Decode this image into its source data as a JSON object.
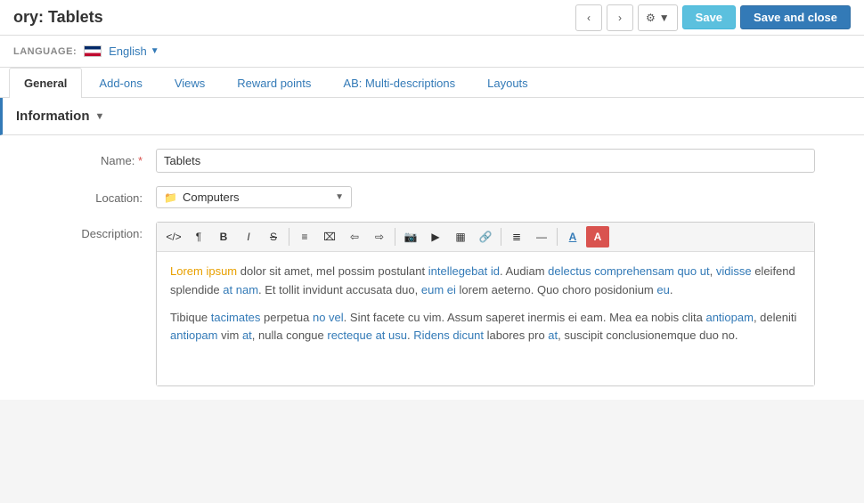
{
  "header": {
    "title": "ory: Tablets",
    "save_label": "Save",
    "save_close_label": "Save and close"
  },
  "language": {
    "label": "LANGUAGE:",
    "current": "English"
  },
  "tabs": [
    {
      "id": "general",
      "label": "General",
      "active": true
    },
    {
      "id": "addons",
      "label": "Add-ons",
      "active": false
    },
    {
      "id": "views",
      "label": "Views",
      "active": false
    },
    {
      "id": "rewardpoints",
      "label": "Reward points",
      "active": false
    },
    {
      "id": "multidesc",
      "label": "AB: Multi-descriptions",
      "active": false
    },
    {
      "id": "layouts",
      "label": "Layouts",
      "active": false
    }
  ],
  "section": {
    "title": "Information"
  },
  "form": {
    "name_label": "Name:",
    "name_required": "*",
    "name_value": "Tablets",
    "location_label": "Location:",
    "location_value": "Computers",
    "description_label": "Description:"
  },
  "editor": {
    "toolbar_buttons": [
      {
        "id": "source",
        "symbol": "</>",
        "title": "Source"
      },
      {
        "id": "paragraph",
        "symbol": "¶",
        "title": "Paragraph"
      },
      {
        "id": "bold",
        "symbol": "B",
        "title": "Bold"
      },
      {
        "id": "italic",
        "symbol": "I",
        "title": "Italic"
      },
      {
        "id": "strikethrough",
        "symbol": "S̶",
        "title": "Strikethrough"
      },
      {
        "id": "unordered-list",
        "symbol": "☰",
        "title": "Unordered List"
      },
      {
        "id": "ordered-list",
        "symbol": "☷",
        "title": "Ordered List"
      },
      {
        "id": "align-left",
        "symbol": "≡",
        "title": "Align Left"
      },
      {
        "id": "align-center",
        "symbol": "≡",
        "title": "Align Center"
      },
      {
        "id": "image",
        "symbol": "🖼",
        "title": "Image"
      },
      {
        "id": "video",
        "symbol": "▶",
        "title": "Video"
      },
      {
        "id": "table",
        "symbol": "⊞",
        "title": "Table"
      },
      {
        "id": "link",
        "symbol": "🔗",
        "title": "Link"
      },
      {
        "id": "align-justify",
        "symbol": "≣",
        "title": "Justify"
      },
      {
        "id": "hr",
        "symbol": "—",
        "title": "Horizontal Rule"
      },
      {
        "id": "font-color",
        "symbol": "A",
        "title": "Font Color"
      },
      {
        "id": "bg-color",
        "symbol": "A",
        "title": "Background Color"
      }
    ],
    "content_paragraphs": [
      "Lorem ipsum dolor sit amet, mel possim postulant intellegebat id. Audiam delectus comprehensam quo ut, vidisse eleifend splendide at nam. Et tollit invidunt accusata duo, eum ei lorem aeterno. Quo choro posidonium eu.",
      "Tibique tacimates perpetua no vel. Sint facete cu vim. Assum saperet inermis ei eam. Mea ea nobis clita antiopam, deleniti antiopam vim at, nulla congue recteque at usu. Ridens dicunt labores pro at, suscipit conclusionemque duo no."
    ]
  }
}
